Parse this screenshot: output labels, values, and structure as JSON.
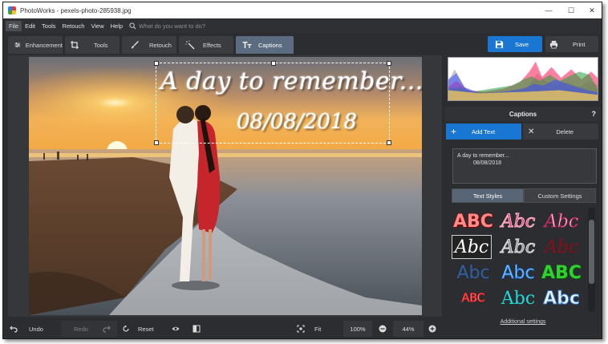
{
  "window": {
    "title": "PhotoWorks - pexels-photo-285938.jpg"
  },
  "menu": {
    "items": [
      "File",
      "Edit",
      "Tools",
      "Retouch",
      "View",
      "Help"
    ],
    "search_placeholder": "What do you want to do?"
  },
  "toolbar": {
    "tabs": [
      "Enhancement",
      "Tools",
      "Retouch",
      "Effects",
      "Captions"
    ],
    "active_tab": "Captions",
    "save_label": "Save",
    "print_label": "Print"
  },
  "canvas": {
    "caption_line1": "A day to remember...",
    "caption_line2": "08/08/2018"
  },
  "panel": {
    "title": "Captions",
    "help": "?",
    "add_label": "Add Text",
    "delete_label": "Delete",
    "text_line1": "A day to remember...",
    "text_line2": "08/08/2018",
    "tab_styles": "Text Styles",
    "tab_custom": "Custom Settings",
    "styles": [
      "ABC",
      "Abc",
      "Abc",
      "Abc",
      "Abc",
      "Abc",
      "Abc",
      "Abc",
      "ABC",
      "ABC",
      "Abc",
      "Abc"
    ],
    "additional_link": "Additional settings"
  },
  "bottom": {
    "undo": "Undo",
    "redo": "Redo",
    "reset": "Reset",
    "fit": "Fit",
    "zoom_100": "100%",
    "zoom_level": "44%"
  },
  "colors": {
    "accent": "#1976d2",
    "active_tab": "#5c6c80",
    "background": "#2b2d30"
  }
}
